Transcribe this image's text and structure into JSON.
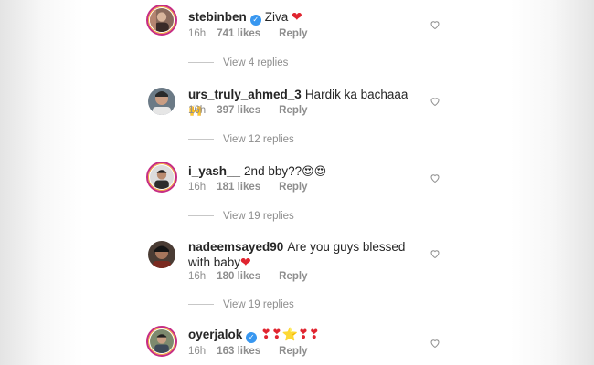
{
  "comments": [
    {
      "username": "stebinben",
      "verified": true,
      "text": "Ziva ",
      "emoji": "❤",
      "time": "16h",
      "likes": "741 likes",
      "reply_label": "Reply",
      "view_replies": "View 4 replies"
    },
    {
      "username": "urs_truly_ahmed_3",
      "verified": false,
      "text": "Hardik ka bachaaa ",
      "emoji": "🙌",
      "time": "16h",
      "likes": "397 likes",
      "reply_label": "Reply",
      "view_replies": "View 12 replies"
    },
    {
      "username": "i_yash__",
      "verified": false,
      "text": "2nd bby??",
      "emoji": "😍😍",
      "time": "16h",
      "likes": "181 likes",
      "reply_label": "Reply",
      "view_replies": "View 19 replies"
    },
    {
      "username": "nadeemsayed90",
      "verified": false,
      "text": "Are you guys blessed with baby",
      "emoji": "❤",
      "time": "16h",
      "likes": "180 likes",
      "reply_label": "Reply",
      "view_replies": "View 19 replies"
    },
    {
      "username": "oyerjalok",
      "verified": true,
      "text": "",
      "emoji": "❣❣⭐❣❣",
      "time": "16h",
      "likes": "163 likes",
      "reply_label": "Reply"
    }
  ],
  "icons": {
    "verified": "verified-badge-icon",
    "like": "heart-outline-icon"
  },
  "colors": {
    "verified": "#3897f0",
    "heart": "#e0242f",
    "meta": "#8e8e8e",
    "story_ring": "#c62d84"
  }
}
